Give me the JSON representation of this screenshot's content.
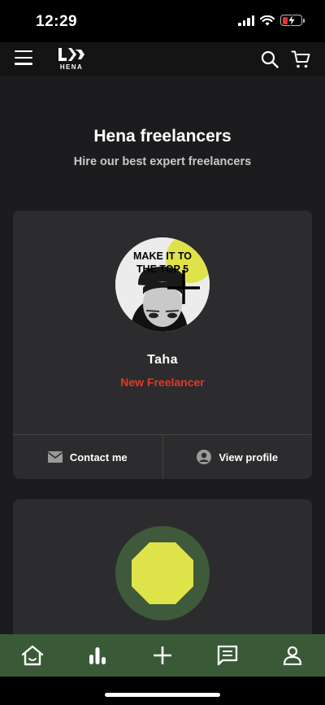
{
  "status_bar": {
    "time": "12:29",
    "icons": [
      "signal-icon",
      "wifi-icon",
      "battery-charging-icon"
    ],
    "battery_color": "#e5322d"
  },
  "header": {
    "logo_text": "HENA",
    "icons": [
      "hamburger-menu-icon",
      "search-icon",
      "cart-icon"
    ]
  },
  "page": {
    "title": "Hena freelancers",
    "subtitle": "Hire our best expert freelancers"
  },
  "cards": [
    {
      "name": "Taha",
      "status": "New Freelancer",
      "status_color": "#e0392b",
      "avatar_text_line1": "MAKE IT TO",
      "avatar_text_line2": "THE TOP 5",
      "contact_label": "Contact me",
      "view_label": "View profile"
    }
  ],
  "bottom_nav": {
    "items": [
      "home-icon",
      "stats-icon",
      "add-icon",
      "messages-icon",
      "profile-icon"
    ],
    "background": "#3a5a37"
  },
  "colors": {
    "background": "#1c1c1e",
    "card": "#2c2c2e",
    "accent_yellow": "#dfe34a",
    "accent_green": "#3e5a3b"
  }
}
